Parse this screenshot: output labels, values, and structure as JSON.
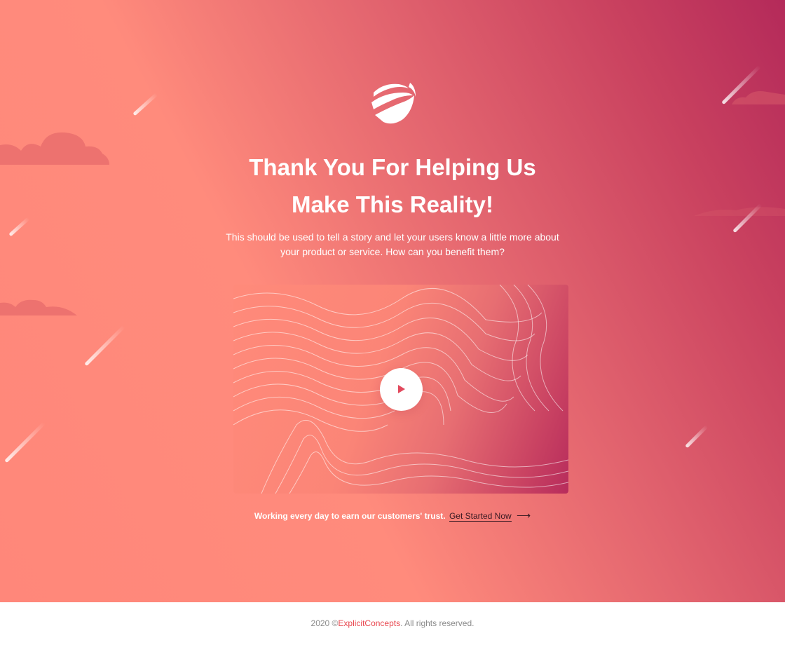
{
  "hero": {
    "title_line1": "Thank You For Helping Us",
    "title_line2": "Make This Reality!",
    "subtitle_line1": "This should be used to tell a story and let your users know a little more about",
    "subtitle_line2": "your product or service. How can you benefit them?",
    "logo_icon": "globe-swoosh-icon"
  },
  "video": {
    "play_icon": "play-icon"
  },
  "trust": {
    "text": "Working every day to earn our customers' trust.",
    "cta_label": "Get Started Now",
    "cta_icon": "arrow-right-icon",
    "arrow_glyph": "⟶"
  },
  "footer": {
    "year_copyright": "2020 ©",
    "brand": "ExplicitConcepts",
    "rights": ". All rights reserved."
  },
  "colors": {
    "gradient_start": "#ff877a",
    "gradient_end": "#b42a5a",
    "accent": "#e8474f",
    "cta_text": "#3a1b24"
  }
}
